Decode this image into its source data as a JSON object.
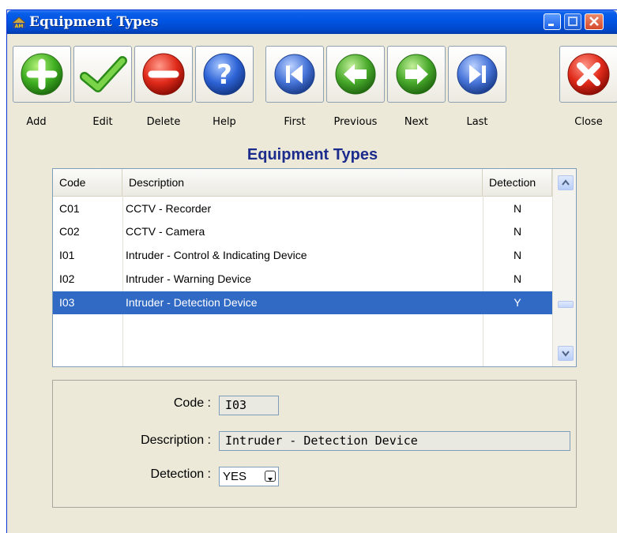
{
  "window": {
    "title": "Equipment Types",
    "app_icon": "am-app-icon"
  },
  "toolbar": [
    {
      "name": "add",
      "label": "Add",
      "icon": "plus-icon"
    },
    {
      "name": "edit",
      "label": "Edit",
      "icon": "checkmark-icon"
    },
    {
      "name": "delete",
      "label": "Delete",
      "icon": "minus-icon"
    },
    {
      "name": "help",
      "label": "Help",
      "icon": "question-icon"
    },
    {
      "name": "first",
      "label": "First",
      "icon": "first-record-icon"
    },
    {
      "name": "previous",
      "label": "Previous",
      "icon": "arrow-left-icon"
    },
    {
      "name": "next",
      "label": "Next",
      "icon": "arrow-right-icon"
    },
    {
      "name": "last",
      "label": "Last",
      "icon": "last-record-icon"
    },
    {
      "name": "close",
      "label": "Close",
      "icon": "close-x-icon"
    }
  ],
  "heading": "Equipment Types",
  "grid": {
    "columns": [
      "Code",
      "Description",
      "Detection"
    ],
    "rows": [
      {
        "code": "C01",
        "description": "CCTV - Recorder",
        "detection": "N"
      },
      {
        "code": "C02",
        "description": "CCTV - Camera",
        "detection": "N"
      },
      {
        "code": "I01",
        "description": "Intruder - Control & Indicating Device",
        "detection": "N"
      },
      {
        "code": "I02",
        "description": "Intruder - Warning Device",
        "detection": "N"
      },
      {
        "code": "I03",
        "description": "Intruder - Detection Device",
        "detection": "Y",
        "selected": true
      }
    ]
  },
  "form": {
    "code_label": "Code :",
    "code_value": "I03",
    "description_label": "Description :",
    "description_value": "Intruder - Detection Device",
    "detection_label": "Detection :",
    "detection_value": "YES"
  },
  "colors": {
    "titlebar": "#0054e3",
    "selection": "#316ac5",
    "heading": "#1c2c8c",
    "window_bg": "#ece9d8"
  }
}
